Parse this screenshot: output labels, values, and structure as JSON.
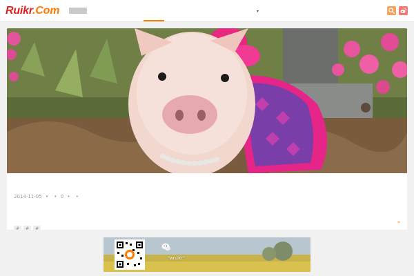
{
  "header": {
    "logo_main": "Ruikr",
    "logo_suffix": ".Com",
    "badge_label": "",
    "nav": [
      {
        "label": "",
        "active": true
      },
      {
        "label": "",
        "active": false
      },
      {
        "label": "",
        "active": false
      },
      {
        "label": "",
        "active": false
      },
      {
        "label": "",
        "active": false,
        "has_dropdown": true
      }
    ],
    "icons": [
      "search-icon",
      "weibo-icon"
    ]
  },
  "post": {
    "image": "piglet-in-pink-dress",
    "title": "",
    "date": "2014-11-05",
    "category": "",
    "comments": "0",
    "views": "",
    "excerpt": "",
    "tags": [
      "#",
      "#",
      "#"
    ],
    "read_more": ""
  },
  "banner": {
    "line1": "",
    "line2": "“wruikr”"
  },
  "colors": {
    "accent": "#ff7a00",
    "logo_red": "#e02020",
    "background": "#f1f1f1"
  }
}
